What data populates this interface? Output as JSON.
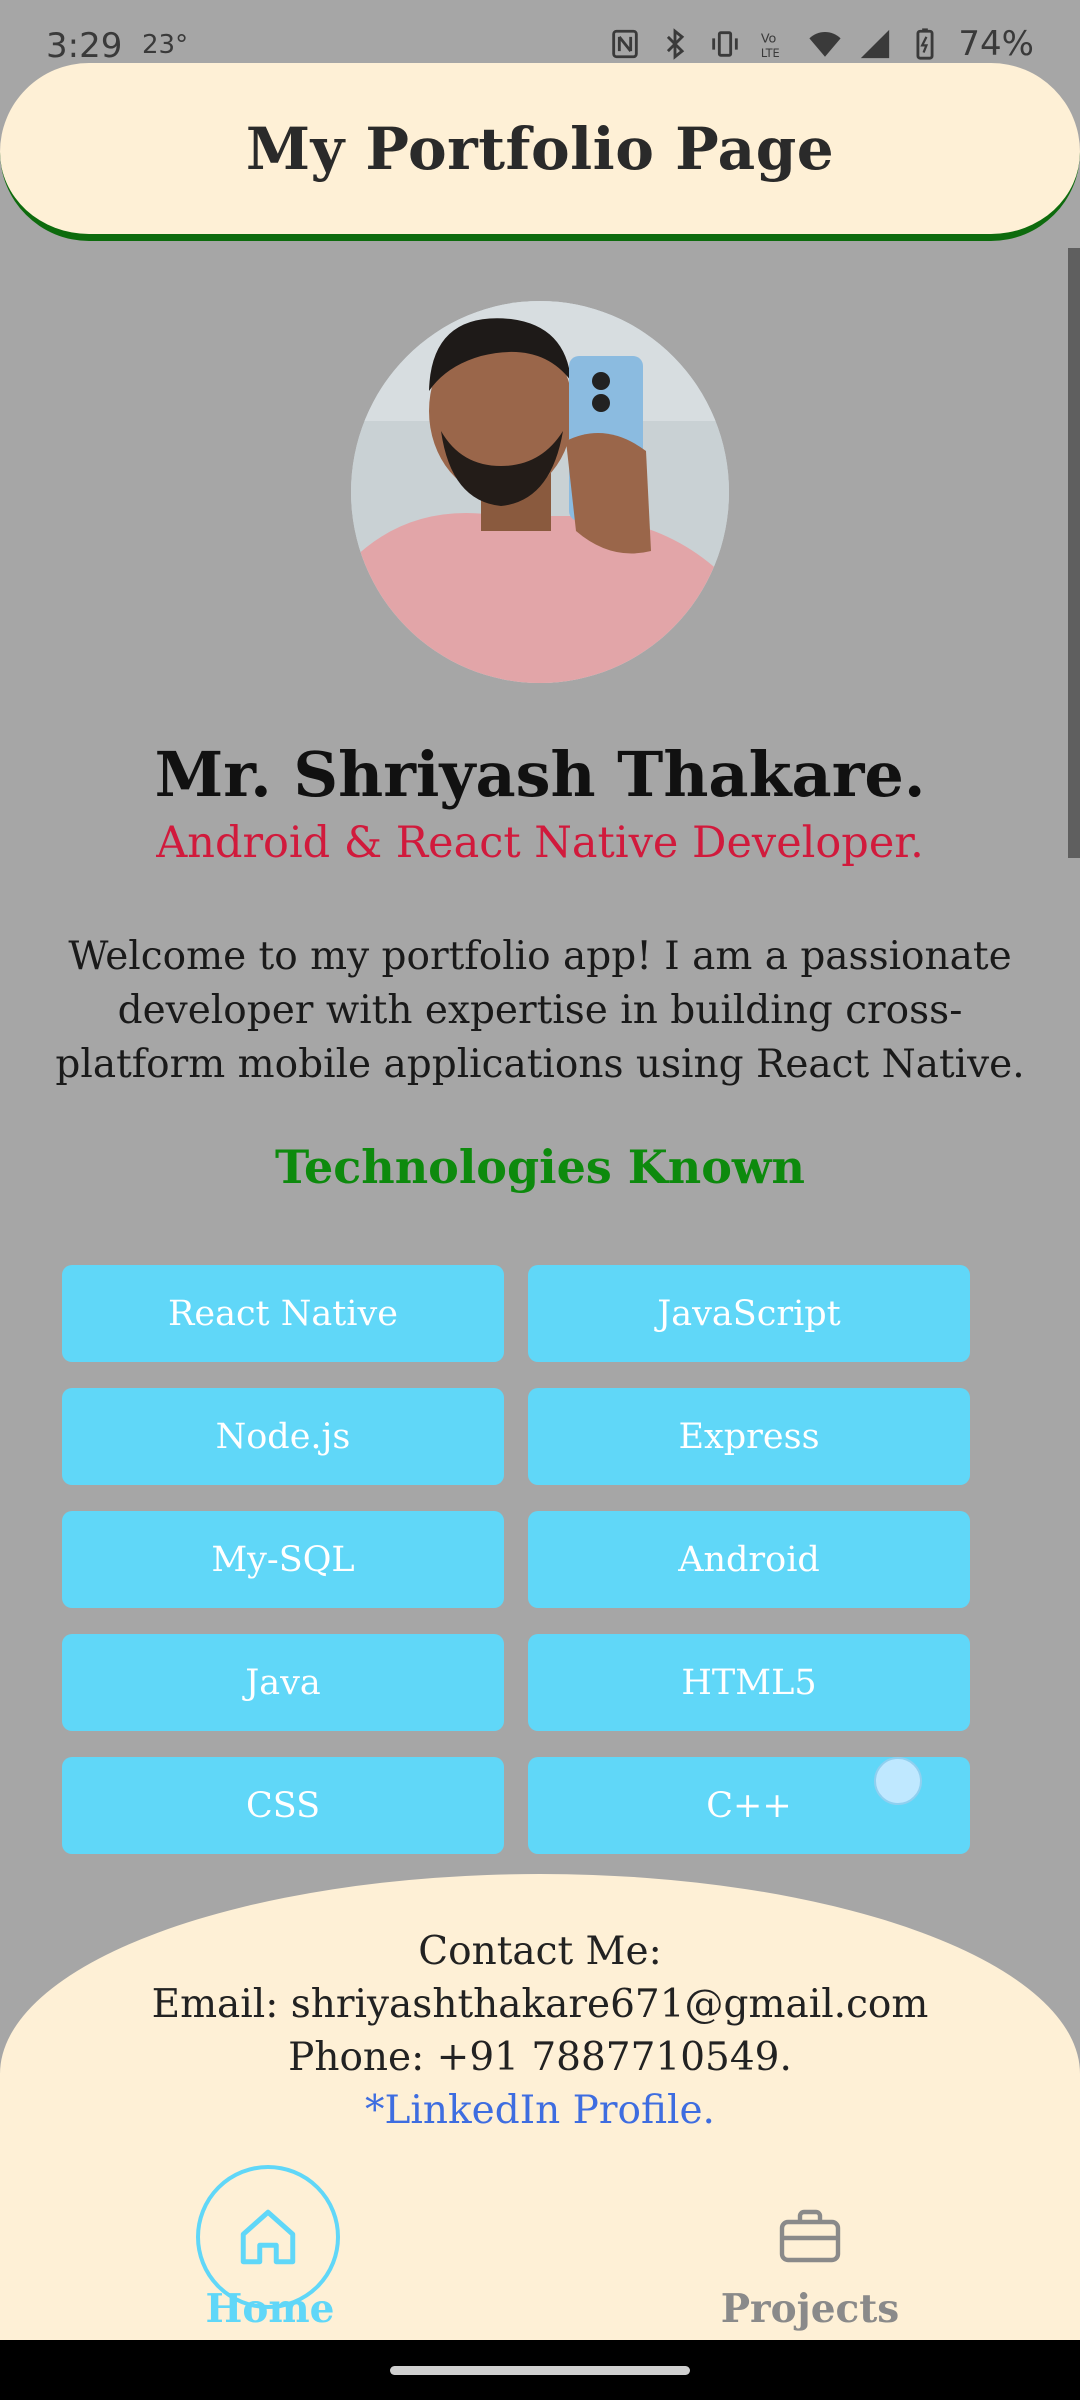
{
  "status_bar": {
    "time": "3:29",
    "temperature": "23°",
    "battery": "74%",
    "icons": [
      "nfc-icon",
      "bluetooth-icon",
      "vibrate-icon",
      "volte-icon",
      "wifi-icon",
      "signal-icon",
      "battery-icon"
    ]
  },
  "header": {
    "title": "My Portfolio Page"
  },
  "profile": {
    "name": "Mr. Shriyash Thakare.",
    "role": "Android & React Native Developer.",
    "intro": "Welcome to my portfolio app! I am a passionate developer with expertise in building cross-platform mobile applications using React Native."
  },
  "technologies": {
    "title": "Technologies Known",
    "items": [
      "React Native",
      "JavaScript",
      "Node.js",
      "Express",
      "My-SQL",
      "Android",
      "Java",
      "HTML5",
      "CSS",
      "C++"
    ]
  },
  "contact": {
    "heading": "Contact Me:",
    "email": "Email: shriyashthakare671@gmail.com",
    "phone": "Phone: +91 7887710549.",
    "linkedin": "*LinkedIn Profile."
  },
  "bottom_nav": {
    "home_label": "Home",
    "projects_label": "Projects",
    "active": "Home"
  },
  "colors": {
    "background": "#a6a6a6",
    "header_bg": "#fef0d6",
    "accent_cyan": "#60d7f8",
    "role_red": "#d11a3c",
    "tech_green": "#0d8a0d",
    "link_blue": "#3e6de0"
  }
}
